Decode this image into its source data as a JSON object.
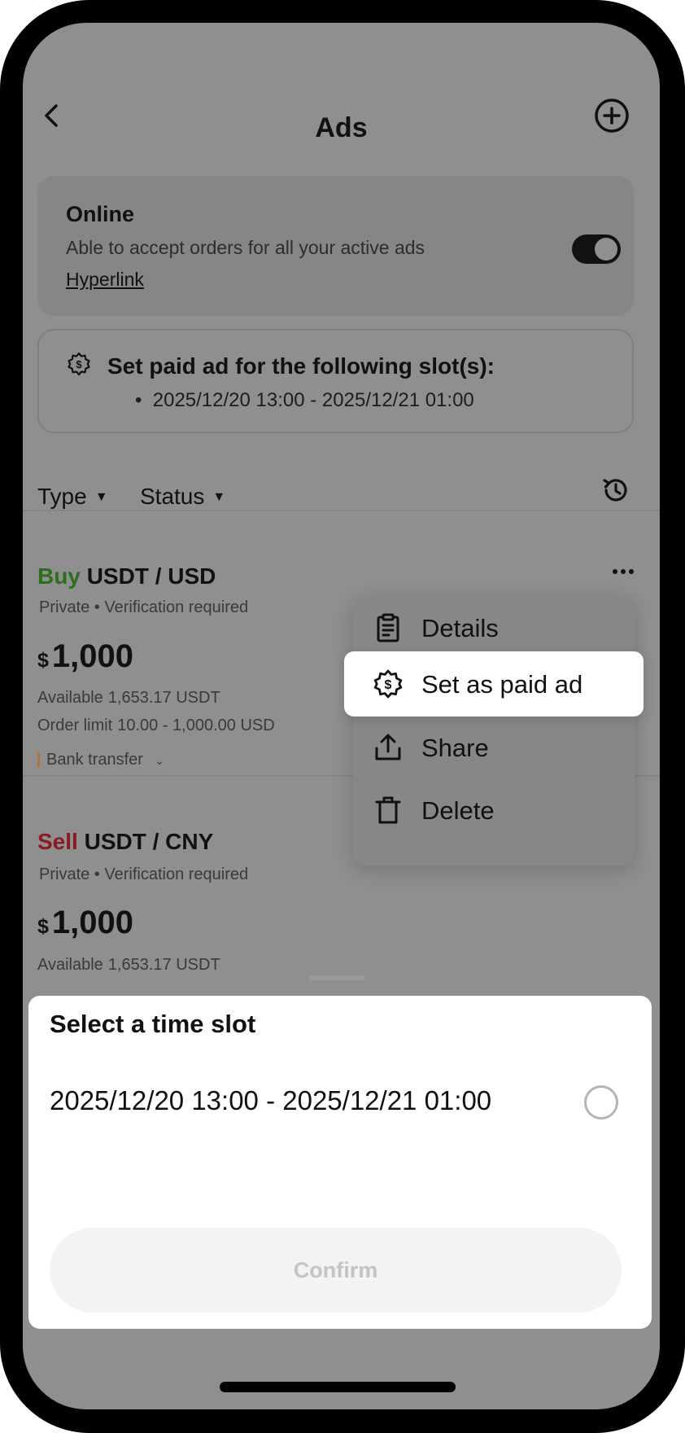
{
  "header": {
    "title": "Ads",
    "back_icon": "chevron-left-icon",
    "add_icon": "plus-circle-icon"
  },
  "online": {
    "title": "Online",
    "description": "Able to accept orders for all your active ads",
    "link": "Hyperlink",
    "toggle_on": true
  },
  "paid_ad_notice": {
    "icon": "dollar-badge-icon",
    "title": "Set paid ad for the following slot(s):",
    "slots": [
      "2025/12/20 13:00 - 2025/12/21 01:00"
    ]
  },
  "filters": {
    "type_label": "Type",
    "status_label": "Status",
    "history_icon": "history-icon"
  },
  "ads": [
    {
      "side": "Buy",
      "pair": "USDT / USD",
      "meta": "Private • Verification required",
      "currency": "$",
      "price": "1,000",
      "available_label": "Available",
      "available_value": "1,653.17 USDT",
      "limit_label": "Order limit",
      "limit_value": "10.00 - 1,000.00 USD",
      "payment_method": "Bank transfer"
    },
    {
      "side": "Sell",
      "pair": "USDT / CNY",
      "meta": "Private • Verification required",
      "currency": "$",
      "price": "1,000",
      "available_label": "Available",
      "available_value": "1,653.17 USDT"
    }
  ],
  "context_menu": {
    "items": [
      {
        "label": "Details",
        "icon": "clipboard-icon"
      },
      {
        "label": "Set as paid ad",
        "icon": "dollar-badge-icon"
      },
      {
        "label": "Share",
        "icon": "share-icon"
      },
      {
        "label": "Delete",
        "icon": "trash-icon"
      }
    ],
    "highlighted_index": 1
  },
  "time_slot_sheet": {
    "title": "Select a time slot",
    "options": [
      {
        "label": "2025/12/20 13:00 - 2025/12/21 01:00",
        "selected": false
      }
    ],
    "confirm_label": "Confirm"
  },
  "colors": {
    "buy": "#2e6e1f",
    "sell": "#8a1b24",
    "overlay_bg": "#8f8f8f",
    "payment_marker": "#b0733a"
  }
}
